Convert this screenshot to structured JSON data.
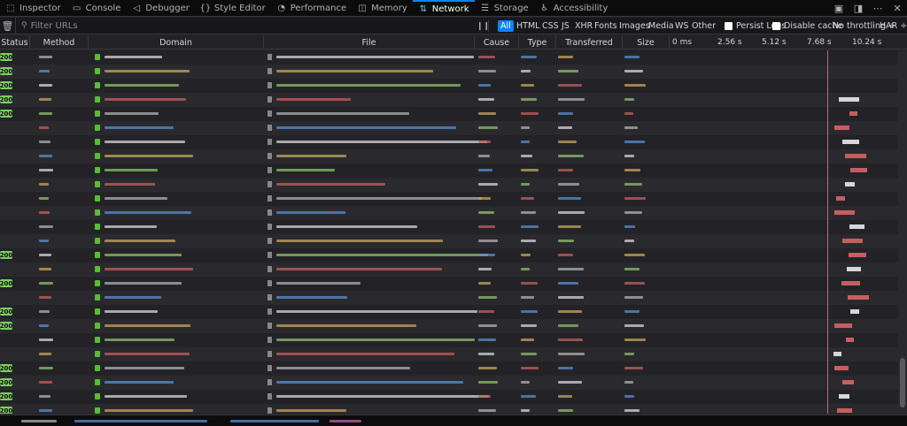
{
  "tabs": [
    {
      "label": "Inspector",
      "icon": "inspector-icon",
      "glyph": "⬚"
    },
    {
      "label": "Console",
      "icon": "console-icon",
      "glyph": "▭"
    },
    {
      "label": "Debugger",
      "icon": "debugger-icon",
      "glyph": "◁"
    },
    {
      "label": "Style Editor",
      "icon": "style-editor-icon",
      "glyph": "{}"
    },
    {
      "label": "Performance",
      "icon": "performance-icon",
      "glyph": "◔"
    },
    {
      "label": "Memory",
      "icon": "memory-icon",
      "glyph": "◫"
    },
    {
      "label": "Network",
      "icon": "network-icon",
      "glyph": "⇅"
    },
    {
      "label": "Storage",
      "icon": "storage-icon",
      "glyph": "☰"
    },
    {
      "label": "Accessibility",
      "icon": "accessibility-icon",
      "glyph": "♿"
    }
  ],
  "selected_tab": "Network",
  "toolbar": {
    "filter_placeholder": "Filter URLs",
    "type_filters": [
      "All",
      "HTML",
      "CSS",
      "JS",
      "XHR",
      "Fonts",
      "Images",
      "Media",
      "WS",
      "Other"
    ],
    "active_type": "All",
    "persist_logs": "Persist Logs",
    "disable_cache": "Disable cache",
    "throttling": "No throttling ÷",
    "har": "HAR ÷"
  },
  "columns": [
    "Status",
    "Method",
    "Domain",
    "File",
    "Cause",
    "Type",
    "Transferred",
    "Size"
  ],
  "timeline_ticks": [
    "0 ms",
    "2.56 s",
    "5.12 s",
    "7.68 s",
    "10.24 s"
  ],
  "status_code": "200",
  "colors": {
    "accent": "#0a84ff",
    "status_ok": "#7fce63",
    "secure": "#57bd35",
    "timeline_marker": "#c55fa7"
  },
  "rows_status_shown": [
    true,
    true,
    true,
    true,
    true,
    false,
    false,
    false,
    false,
    false,
    false,
    false,
    false,
    false,
    true,
    false,
    true,
    false,
    true,
    true,
    false,
    false,
    true,
    true,
    true,
    true
  ]
}
